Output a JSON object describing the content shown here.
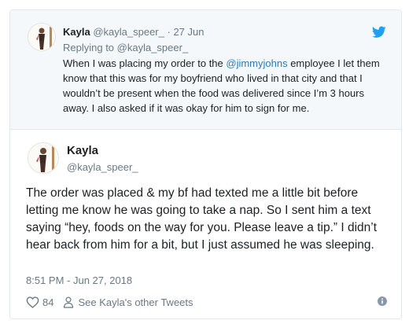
{
  "quoted_tweet": {
    "author_name": "Kayla",
    "author_handle": "@kayla_speer_",
    "separator": "·",
    "date": "27 Jun",
    "replying_to": "Replying to @kayla_speer_",
    "text_before_mention": "When I was placing my order to the ",
    "mention": "@jimmyjohns",
    "text_after_mention": " employee I let them know that this was for my boyfriend who lived in that city and that I wouldn’t be present when the food was delivered since I’m 3 hours away. I also asked if it was okay for him to sign for me."
  },
  "main_tweet": {
    "author_name": "Kayla",
    "author_handle": "@kayla_speer_",
    "text": "The order was placed & my bf had texted me a little bit before letting me know he was going to take a nap. So I sent him a text saying “hey, foods on the way for you. Please leave a tip.” I didn’t hear back from him for a bit, but I just assumed he was sleeping.",
    "timestamp": "8:51 PM - Jun 27, 2018"
  },
  "actions": {
    "like_count": "84",
    "see_other_tweets": "See Kayla's other Tweets"
  },
  "icons": {
    "brand": "twitter-bird-icon",
    "like": "heart-icon",
    "profile": "person-icon",
    "info": "info-icon"
  },
  "colors": {
    "twitter_blue": "#1da1f2",
    "mention": "#2b7bb9",
    "secondary_text": "#697882",
    "quoted_background": "#f5f8fa",
    "border": "#e1e8ed"
  }
}
